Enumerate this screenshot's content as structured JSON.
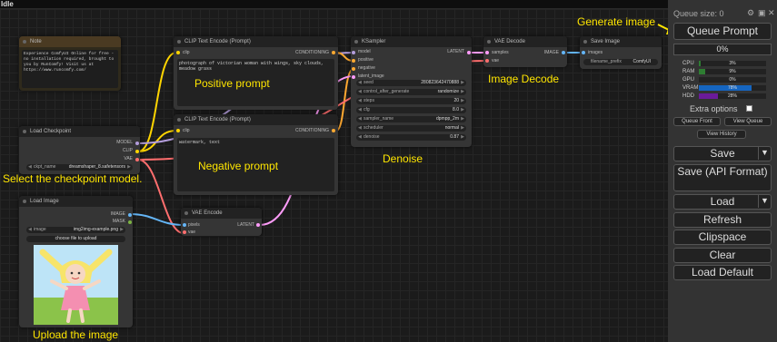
{
  "window": {
    "status": "Idle"
  },
  "annotations": {
    "generate_image": "Generate image",
    "positive_prompt": "Positive prompt",
    "negative_prompt": "Negative prompt",
    "denoise": "Denoise",
    "image_decode": "Image Decode",
    "select_checkpoint": "Select the checkpoint model.",
    "upload_image": "Upload the image"
  },
  "nodes": {
    "note": {
      "title": "Note",
      "text": "Experience ComfyUI Online for free - no installation required, brought to you by RunComfy! Visit us at https://www.runcomfy.com/"
    },
    "clip_positive": {
      "title": "CLIP Text Encode (Prompt)",
      "input": "clip",
      "output": "CONDITIONING",
      "text": "photograph of victorian woman with wings, sky clouds, meadow grass"
    },
    "clip_negative": {
      "title": "CLIP Text Encode (Prompt)",
      "input": "clip",
      "output": "CONDITIONING",
      "text": "watermark, text"
    },
    "ksampler": {
      "title": "KSampler",
      "inputs": [
        "model",
        "positive",
        "negative",
        "latent_image"
      ],
      "output": "LATENT",
      "widgets": [
        {
          "label": "seed",
          "value": "280823642470888"
        },
        {
          "label": "control_after_generate",
          "value": "randomize"
        },
        {
          "label": "steps",
          "value": "20"
        },
        {
          "label": "cfg",
          "value": "8.0"
        },
        {
          "label": "sampler_name",
          "value": "dpmpp_2m"
        },
        {
          "label": "scheduler",
          "value": "normal"
        },
        {
          "label": "denoise",
          "value": "0.87"
        }
      ]
    },
    "vae_decode": {
      "title": "VAE Decode",
      "inputs": [
        "samples",
        "vae"
      ],
      "output": "IMAGE"
    },
    "save_image": {
      "title": "Save Image",
      "input": "images",
      "widget_label": "filename_prefix",
      "widget_value": "ComfyUI"
    },
    "load_checkpoint": {
      "title": "Load Checkpoint",
      "outputs": [
        "MODEL",
        "CLIP",
        "VAE"
      ],
      "widget_label": "ckpt_name",
      "widget_value": "dreamshaper_8.safetensors"
    },
    "load_image": {
      "title": "Load Image",
      "outputs": [
        "IMAGE",
        "MASK"
      ],
      "widget_label": "image",
      "widget_value": "img2img-example.png",
      "upload_label": "choose file to upload"
    },
    "vae_encode": {
      "title": "VAE Encode",
      "inputs": [
        "pixels",
        "vae"
      ],
      "output": "LATENT"
    }
  },
  "panel": {
    "queue_size": "Queue size: 0",
    "queue_prompt": "Queue Prompt",
    "progress": "0%",
    "resources": [
      {
        "name": "CPU",
        "value": "3%",
        "fraction": 0.03,
        "color": "#2e7d32"
      },
      {
        "name": "RAM",
        "value": "9%",
        "fraction": 0.09,
        "color": "#2e7d32"
      },
      {
        "name": "GPU",
        "value": "0%",
        "fraction": 0.0,
        "color": "#2e7d32"
      },
      {
        "name": "VRAM",
        "value": "78%",
        "fraction": 0.78,
        "color": "#1565c0"
      },
      {
        "name": "HDD",
        "value": "28%",
        "fraction": 0.28,
        "color": "#6a1b9a"
      }
    ],
    "extra_options": "Extra options",
    "queue_front": "Queue Front",
    "view_queue": "View Queue",
    "view_history": "View History",
    "save": "Save",
    "save_api": "Save (API Format)",
    "load": "Load",
    "refresh": "Refresh",
    "clipspace": "Clipspace",
    "clear": "Clear",
    "load_default": "Load Default"
  },
  "colors": {
    "annotation": "#ffe600",
    "wire_clip": "#ffd500",
    "wire_model": "#b39ddb",
    "wire_vae": "#ff6e6e",
    "wire_latent": "#ff9cf9",
    "wire_image": "#64b5f6",
    "wire_conditioning": "#ffa931"
  }
}
